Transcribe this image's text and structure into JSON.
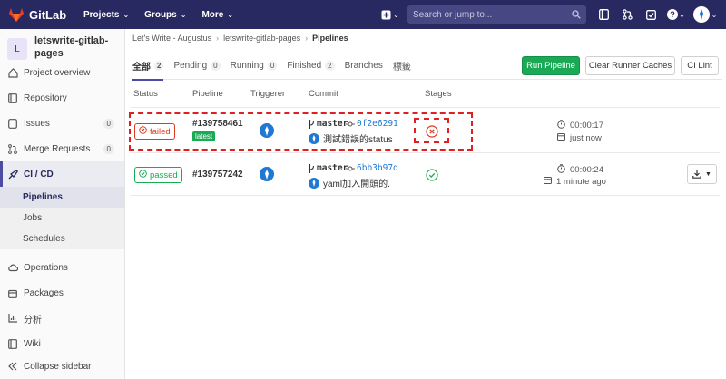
{
  "navbar": {
    "brand": "GitLab",
    "menu": [
      "Projects",
      "Groups",
      "More"
    ],
    "search_placeholder": "Search or jump to..."
  },
  "sidebar": {
    "project_letter": "L",
    "project_name_line1": "letswrite-gitlab-",
    "project_name_line2": "pages",
    "items": [
      {
        "label": "Project overview",
        "icon": "home-icon"
      },
      {
        "label": "Repository",
        "icon": "book-icon"
      },
      {
        "label": "Issues",
        "icon": "issues-icon",
        "count": "0"
      },
      {
        "label": "Merge Requests",
        "icon": "merge-request-icon",
        "count": "0"
      },
      {
        "label": "CI / CD",
        "icon": "rocket-icon"
      }
    ],
    "sub_items": [
      "Pipelines",
      "Jobs",
      "Schedules"
    ],
    "items_bottom": [
      {
        "label": "Operations",
        "icon": "cloud-gear-icon"
      },
      {
        "label": "Packages",
        "icon": "package-icon"
      },
      {
        "label": "分析",
        "icon": "chart-icon"
      },
      {
        "label": "Wiki",
        "icon": "book-icon"
      }
    ],
    "collapse": "Collapse sidebar"
  },
  "breadcrumb": [
    "Let's Write - Augustus",
    "letswrite-gitlab-pages",
    "Pipelines"
  ],
  "tabs": [
    {
      "label": "全部",
      "count": "2"
    },
    {
      "label": "Pending",
      "count": "0"
    },
    {
      "label": "Running",
      "count": "0"
    },
    {
      "label": "Finished",
      "count": "2"
    },
    {
      "label": "Branches",
      "count": null
    },
    {
      "label": "標籤",
      "count": null
    }
  ],
  "buttons": {
    "run_pipeline": "Run Pipeline",
    "clear_caches": "Clear Runner Caches",
    "ci_lint": "CI Lint"
  },
  "table": {
    "headers": [
      "Status",
      "Pipeline",
      "Triggerer",
      "Commit",
      "Stages"
    ],
    "rows": [
      {
        "status": "failed",
        "pipeline_id": "#139758461",
        "tag": "latest",
        "branch": "master",
        "sha": "0f2e6291",
        "message": "測試錯誤的status",
        "stage": "failed",
        "duration": "00:00:17",
        "finished": "just now"
      },
      {
        "status": "passed",
        "pipeline_id": "#139757242",
        "tag": null,
        "branch": "master",
        "sha": "6bb3b97d",
        "message": "yaml加入開頭的.",
        "stage": "passed",
        "duration": "00:00:24",
        "finished": "1 minute ago"
      }
    ]
  },
  "colors": {
    "navbar": "#292961",
    "failed": "#db3b21",
    "passed": "#1aaa55",
    "link": "#1f78d1",
    "annotation": "#e02020"
  }
}
